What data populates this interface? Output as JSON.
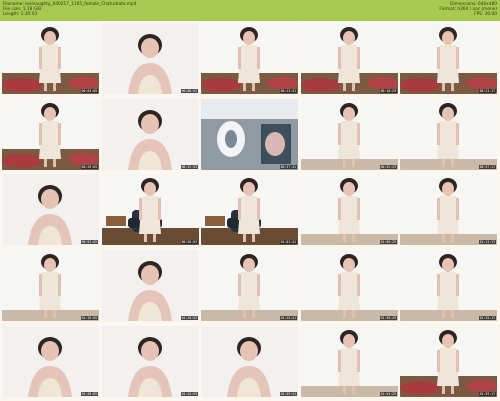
{
  "header": {
    "filename": "Filename: lexinaughty_040217_1105_female_Chaturbate.mp4",
    "filesize": "File size: 1.18 GiB",
    "length": "Length: 1:30:03",
    "dimensions": "Dimensions: 640x480",
    "format": "Format: h264 / aac (mone)",
    "fps": "FPS: 30.00",
    "bar_color": "#a7c94f"
  },
  "thumbnails": [
    {
      "scene": "room-floor-rug",
      "time": "00:04:05"
    },
    {
      "scene": "closeup-wall",
      "time": "00:08:53"
    },
    {
      "scene": "room-floor-rug",
      "time": "00:13:41"
    },
    {
      "scene": "room-floor-rug",
      "time": "00:18:29"
    },
    {
      "scene": "room-floor-rug",
      "time": "00:23:17"
    },
    {
      "scene": "room-floor-rug",
      "time": "00:28:05"
    },
    {
      "scene": "closeup-wall",
      "time": "00:32:53"
    },
    {
      "scene": "closeup-dark",
      "time": "00:37:41"
    },
    {
      "scene": "standing-wall",
      "time": "00:42:29"
    },
    {
      "scene": "standing-wall",
      "time": "00:47:17"
    },
    {
      "scene": "closeup-wall",
      "time": "00:52:05"
    },
    {
      "scene": "chair-room",
      "time": "00:56:53"
    },
    {
      "scene": "chair-room",
      "time": "01:01:41"
    },
    {
      "scene": "standing-wall",
      "time": "01:06:29"
    },
    {
      "scene": "standing-wall",
      "time": "01:11:17"
    },
    {
      "scene": "standing-wall",
      "time": "01:16:05"
    },
    {
      "scene": "closeup-wall",
      "time": "01:20:53"
    },
    {
      "scene": "standing-wall",
      "time": "01:25:41"
    },
    {
      "scene": "standing-wall",
      "time": "01:30:29"
    },
    {
      "scene": "standing-wall",
      "time": "01:35:17"
    },
    {
      "scene": "closeup-wall",
      "time": "01:40:05"
    },
    {
      "scene": "closeup-wall",
      "time": "01:44:53"
    },
    {
      "scene": "closeup-wall",
      "time": "01:49:41"
    },
    {
      "scene": "standing-wall",
      "time": "01:54:29"
    },
    {
      "scene": "room-floor-rug",
      "time": "01:59:17"
    }
  ]
}
